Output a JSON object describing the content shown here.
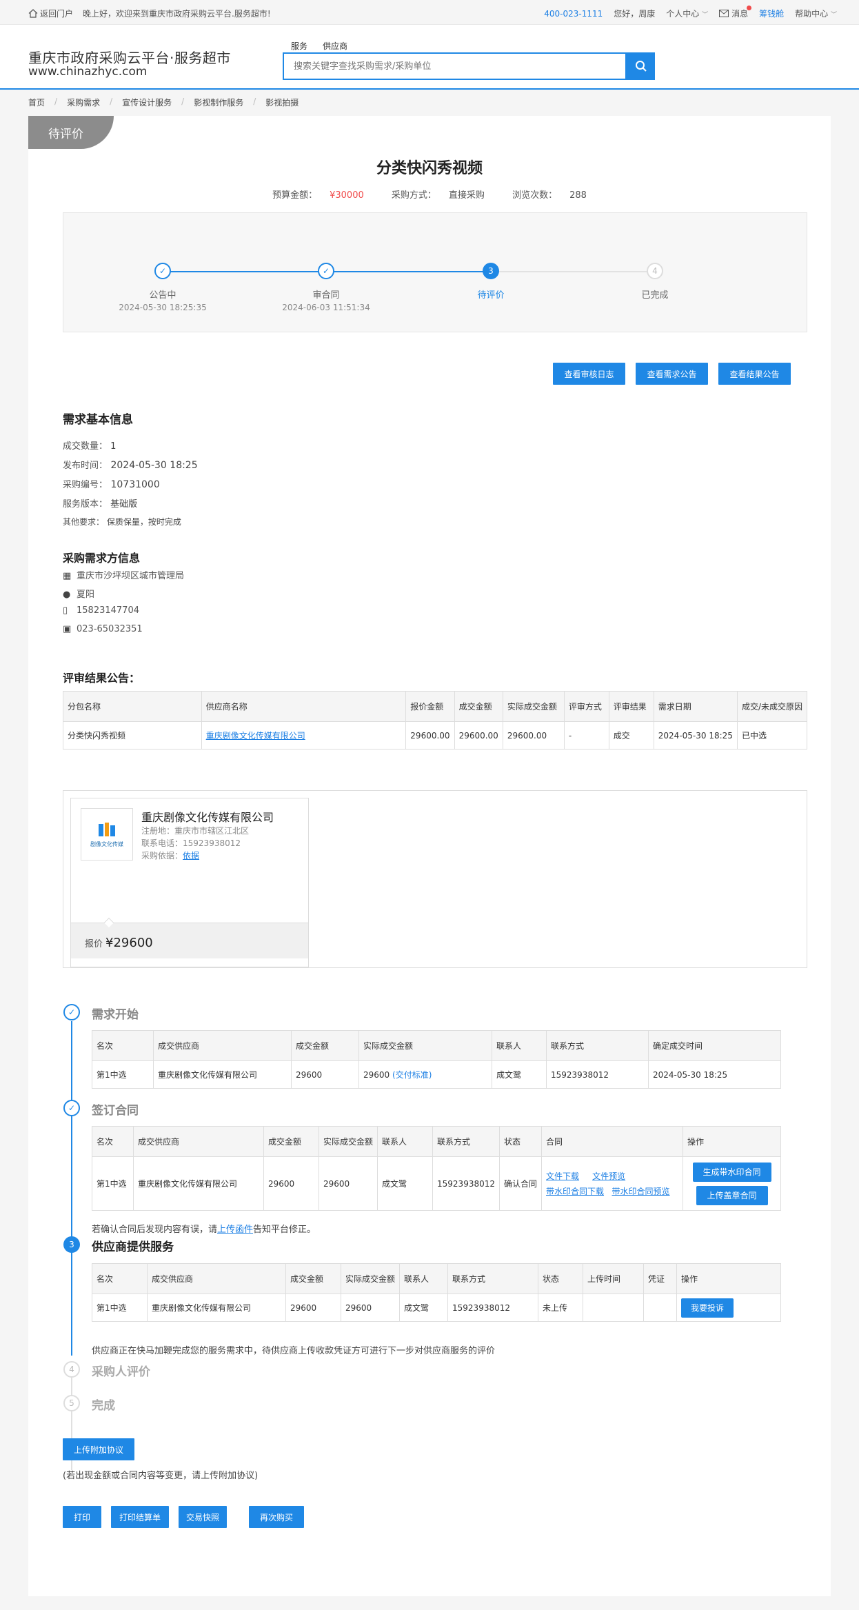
{
  "topbar": {
    "home_link": "返回门户",
    "greeting": "晚上好，欢迎来到重庆市政府采购云平台.服务超市!",
    "phone": "400-023-1111",
    "user": "您好，周康",
    "personal_center": "个人中心",
    "messages": "消息",
    "fsq": "筹钱舱",
    "help_center": "帮助中心"
  },
  "header": {
    "logo_title": "重庆市政府采购云平台·服务超市",
    "logo_url": "www.chinazhyc.com",
    "search_tabs": [
      "服务",
      "供应商"
    ],
    "search_placeholder": "搜索关键字查找采购需求/采购单位"
  },
  "breadcrumb": [
    "首页",
    "采购需求",
    "宣传设计服务",
    "影视制作服务",
    "影视拍摄"
  ],
  "status_ribbon": "待评价",
  "project": {
    "title": "分类快闪秀视频",
    "budget_label": "预算金额：",
    "budget_value": "¥30000",
    "method_label": "采购方式：",
    "method_value": "直接采购",
    "views_label": "浏览次数：",
    "views_value": "288"
  },
  "steps": [
    {
      "num": "1",
      "label": "公告中",
      "date": "2024-05-30 18:25:35",
      "state": "done"
    },
    {
      "num": "2",
      "label": "审合同",
      "date": "2024-06-03 11:51:34",
      "state": "done"
    },
    {
      "num": "3",
      "label": "待评价",
      "date": "",
      "state": "current"
    },
    {
      "num": "4",
      "label": "已完成",
      "date": "",
      "state": "future"
    }
  ],
  "action_buttons": [
    "查看审核日志",
    "查看需求公告",
    "查看结果公告"
  ],
  "basic_info": {
    "heading": "需求基本信息",
    "rows": [
      {
        "label": "成交数量：",
        "value": "1"
      },
      {
        "label": "发布时间：",
        "value": "2024-05-30 18:25"
      },
      {
        "label": "采购编号：",
        "value": "10731000"
      },
      {
        "label": "服务版本：",
        "value": "基础版"
      },
      {
        "label": "其他要求：",
        "value": "保质保量，按时完成"
      }
    ]
  },
  "buyer_info": {
    "heading": "采购需求方信息",
    "org": "重庆市沙坪坝区城市管理局",
    "contact": "夏阳",
    "mobile": "15823147704",
    "phone": "023-65032351"
  },
  "result_notice": {
    "heading": "评审结果公告：",
    "headers": [
      "分包名称",
      "供应商名称",
      "报价金额",
      "成交金额",
      "实际成交金额",
      "评审方式",
      "评审结果",
      "需求日期",
      "成交/未成交原因"
    ],
    "row": [
      "分类快闪秀视频",
      "重庆剧像文化传媒有限公司",
      "29600.00",
      "29600.00",
      "29600.00",
      "-",
      "成交",
      "2024-05-30 18:25",
      "已中选"
    ]
  },
  "vendor_card": {
    "logo_text": "剧像文化传媒",
    "name": "重庆剧像文化传媒有限公司",
    "reg_label": "注册地：",
    "reg_value": "重庆市市辖区江北区",
    "phone_label": "联系电话：",
    "phone_value": "15923938012",
    "basis_label": "采购依据：",
    "basis_value": "依据",
    "price_label": "报价",
    "price_value": "¥29600"
  },
  "timeline": {
    "step1": {
      "title": "需求开始",
      "headers": [
        "名次",
        "成交供应商",
        "成交金额",
        "实际成交金额",
        "联系人",
        "联系方式",
        "确定成交时间"
      ],
      "row": [
        "第1中选",
        "重庆剧像文化传媒有限公司",
        "29600",
        "29600",
        "成文鹭",
        "15923938012",
        "2024-05-30 18:25"
      ],
      "delivery_std": "(交付标准)"
    },
    "step2": {
      "title": "签订合同",
      "headers": [
        "名次",
        "成交供应商",
        "成交金额",
        "实际成交金额",
        "联系人",
        "联系方式",
        "状态",
        "合同",
        "操作"
      ],
      "row": [
        "第1中选",
        "重庆剧像文化传媒有限公司",
        "29600",
        "29600",
        "成文鹭",
        "15923938012",
        "确认合同"
      ],
      "contract_links": [
        "文件下载",
        "文件预览",
        "带水印合同下载",
        "带水印合同预览"
      ],
      "ops": [
        "生成带水印合同",
        "上传盖章合同"
      ],
      "note_before": "若确认合同后发现内容有误，请",
      "note_link": "上传函件",
      "note_after": "告知平台修正。"
    },
    "step3": {
      "num": "3",
      "title": "供应商提供服务",
      "headers": [
        "名次",
        "成交供应商",
        "成交金额",
        "实际成交金额",
        "联系人",
        "联系方式",
        "状态",
        "上传时间",
        "凭证",
        "操作"
      ],
      "row": [
        "第1中选",
        "重庆剧像文化传媒有限公司",
        "29600",
        "29600",
        "成文鹭",
        "15923938012",
        "未上传",
        "",
        ""
      ],
      "op": "我要投诉",
      "note": "供应商正在快马加鞭完成您的服务需求中，待供应商上传收款凭证方可进行下一步对供应商服务的评价"
    },
    "step4": {
      "num": "4",
      "title": "采购人评价"
    },
    "step5": {
      "num": "5",
      "title": "完成"
    }
  },
  "upload_agreement": {
    "button": "上传附加协议",
    "note": "(若出现金额或合同内容等变更，请上传附加协议)"
  },
  "bottom_buttons": [
    "打印",
    "打印结算单",
    "交易快照",
    "再次购买"
  ]
}
